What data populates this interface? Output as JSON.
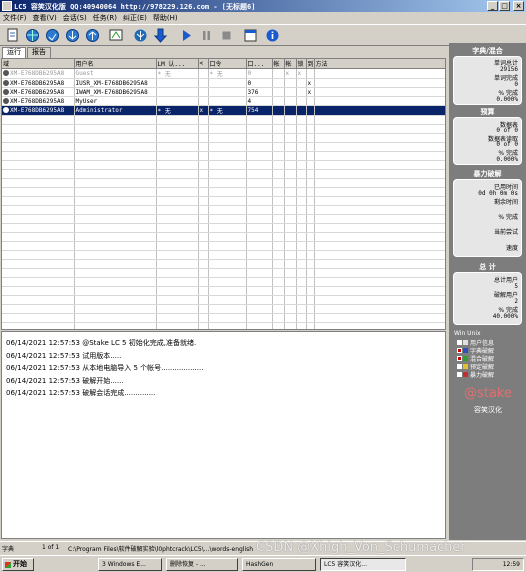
{
  "window": {
    "title": "LC5 容笑汉化版 QQ:40940064 http://978229.126.com - [无标题6]",
    "min_label": "_",
    "max_label": "□",
    "close_label": "×"
  },
  "menu": [
    "文件(F)",
    "查看(V)",
    "会话(S)",
    "任务(R)",
    "纠正(E)",
    "帮助(H)"
  ],
  "tabs": {
    "run": "运行",
    "report": "报告"
  },
  "grid": {
    "columns": [
      "域",
      "用户名",
      "LM 认...",
      "<",
      "口令",
      "口...",
      "帐",
      "帐",
      "锁",
      "到",
      "方法"
    ],
    "rows": [
      {
        "domain": "XM-E768DB6295A8",
        "user": "Guest",
        "lm": "* 无",
        "lt": "",
        "pw": "* 无",
        "len": "0",
        "c6": "",
        "c7": "x",
        "c8": "x",
        "c9": "",
        "method": ""
      },
      {
        "domain": "XM-E768DB6295A8",
        "user": "IUSR_XM-E768DB6295A8",
        "lm": "",
        "lt": "",
        "pw": "",
        "len": "0",
        "c6": "",
        "c7": "",
        "c8": "",
        "c9": "x",
        "method": ""
      },
      {
        "domain": "XM-E768DB6295A8",
        "user": "IWAM_XM-E768DB6295A8",
        "lm": "",
        "lt": "",
        "pw": "",
        "len": "376",
        "c6": "",
        "c7": "",
        "c8": "",
        "c9": "x",
        "method": ""
      },
      {
        "domain": "XM-E768DB6295A8",
        "user": "MyUser",
        "lm": "",
        "lt": "",
        "pw": "",
        "len": "4",
        "c6": "",
        "c7": "",
        "c8": "",
        "c9": "",
        "method": ""
      },
      {
        "domain": "XM-E768DB6295A8",
        "user": "Administrator",
        "lm": "* 无",
        "lt": "x",
        "pw": "* 无",
        "len": "754",
        "c6": "",
        "c7": "",
        "c8": "",
        "c9": "",
        "method": ""
      }
    ]
  },
  "log": [
    "06/14/2021 12:57:53 @Stake LC 5 初始化完成,准备就绪.",
    "06/14/2021 12:57:53 试用版本.....",
    "06/14/2021 12:57:53 从本地电脑导入 5 个帐号...................",
    "06/14/2021 12:57:53 破解开始......",
    "06/14/2021 12:57:53 破解会话完成.............."
  ],
  "side": {
    "dict_head": "字典/混合",
    "dict": {
      "words_total_label": "单词总计",
      "words_total": "29156",
      "words_done_label": "单词完成",
      "words_done": "0",
      "pct_label": "% 完成",
      "pct": "0.000%"
    },
    "prec_head": "预算",
    "prec": {
      "a_label": "数据表",
      "a_val": "0 of 0",
      "b_label": "数据表读取",
      "b_val": "0 of 0",
      "pct_label": "% 完成",
      "pct": "0.000%"
    },
    "brute_head": "暴力破解",
    "brute": {
      "elapsed_label": "已用时间",
      "elapsed": "0d 0h 0m 0s",
      "remain_label": "剩余时间",
      "pct_label": "% 完成",
      "current_label": "当前尝试",
      "speed_label": "速度"
    },
    "total_head": "总 计",
    "total": {
      "users_label": "总计用户",
      "users": "5",
      "cracked_label": "破解用户",
      "cracked": "2",
      "pct_label": "% 完成",
      "pct": "40.000%"
    },
    "legend_head": "Win Unix",
    "legend": [
      {
        "label": "用户信息",
        "checked": false,
        "color": "#e0e0e0"
      },
      {
        "label": "字典破解",
        "checked": true,
        "color": "#3050c0"
      },
      {
        "label": "混合破解",
        "checked": true,
        "color": "#30a030"
      },
      {
        "label": "预定破解",
        "checked": false,
        "color": "#e0c030"
      },
      {
        "label": "暴力破解",
        "checked": false,
        "color": "#c03030"
      }
    ],
    "brand": "@stake",
    "brand_sub": "容笑汉化"
  },
  "statusbar": {
    "left": "字典",
    "pos": "1 of 1",
    "path": "C:\\Program Files\\软件破解实验\\l0phtcrack\\LC5\\...\\words-english"
  },
  "taskbar": {
    "start": "开始",
    "tasks": [
      "3 Windows E...",
      "删除恢复 - ...",
      "HashGen",
      "LC5 容笑汉化..."
    ],
    "clock": "12:59"
  },
  "watermark": "CSDN @Xhigh_Von_Schumacher"
}
